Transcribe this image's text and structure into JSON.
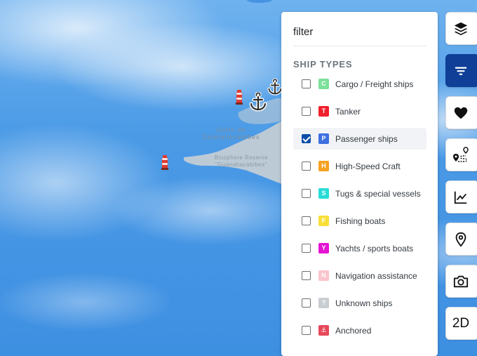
{
  "map": {
    "gulf_label": "Golfo de\nGuanahacabibes",
    "reserve_label": "Biosphere Reserve\n\"Guanahacabibes\""
  },
  "filter_panel": {
    "title": "filter",
    "section_title": "SHIP TYPES",
    "ship_types": [
      {
        "label": "Cargo / Freight ships",
        "badge": "C",
        "color": "#7be09a",
        "checked": false
      },
      {
        "label": "Tanker",
        "badge": "T",
        "color": "#f0202c",
        "checked": false
      },
      {
        "label": "Passenger ships",
        "badge": "P",
        "color": "#3c6fe0",
        "checked": true
      },
      {
        "label": "High-Speed Craft",
        "badge": "H",
        "color": "#f5a123",
        "checked": false
      },
      {
        "label": "Tugs & special vessels",
        "badge": "S",
        "color": "#27dcd8",
        "checked": false
      },
      {
        "label": "Fishing boats",
        "badge": "F",
        "color": "#f7df37",
        "checked": false
      },
      {
        "label": "Yachts / sports boats",
        "badge": "Y",
        "color": "#e514d4",
        "checked": false
      },
      {
        "label": "Navigation assistance",
        "badge": "N",
        "color": "#fbc4cc",
        "checked": false
      },
      {
        "label": "Unknown ships",
        "badge": "?",
        "color": "#c8cdd2",
        "checked": false
      },
      {
        "label": "Anchored",
        "badge": "⚓",
        "color": "#e7485a",
        "checked": false
      }
    ]
  },
  "toolbar": {
    "buttons": [
      {
        "name": "layers",
        "icon": "layers-icon",
        "active": false
      },
      {
        "name": "filter",
        "icon": "filter-icon",
        "active": true
      },
      {
        "name": "favorites",
        "icon": "heart-icon",
        "active": false
      },
      {
        "name": "route",
        "icon": "route-icon",
        "active": false
      },
      {
        "name": "statistics",
        "icon": "chart-icon",
        "active": false
      },
      {
        "name": "location",
        "icon": "location-pin-icon",
        "active": false
      },
      {
        "name": "camera",
        "icon": "camera-icon",
        "active": false
      },
      {
        "name": "view-mode",
        "label": "2D",
        "active": false
      }
    ]
  }
}
